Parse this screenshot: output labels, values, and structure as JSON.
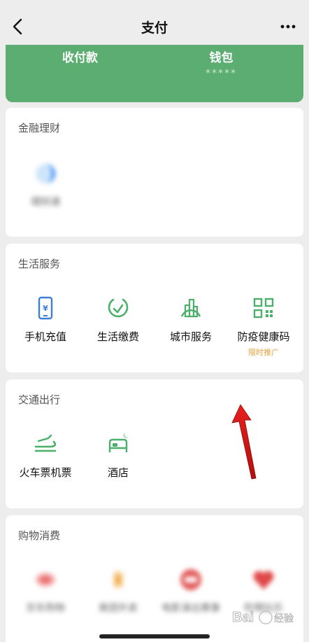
{
  "nav": {
    "title": "支付",
    "back_icon": "chevron-left-icon",
    "more_icon": "more-dots-icon"
  },
  "wallet": {
    "receive_label": "收付款",
    "wallet_label": "钱包",
    "wallet_balance": "*****",
    "color": "#5cad72"
  },
  "finance": {
    "title": "金融理财",
    "items": [
      {
        "label": "理财通",
        "icon": "licaitong-icon"
      }
    ]
  },
  "life": {
    "title": "生活服务",
    "items": [
      {
        "label": "手机充值",
        "icon": "phone-recharge-icon"
      },
      {
        "label": "生活缴费",
        "icon": "utility-payment-icon"
      },
      {
        "label": "城市服务",
        "icon": "city-service-icon"
      },
      {
        "label": "防疫健康码",
        "icon": "health-code-icon",
        "tag": "限时推广"
      }
    ]
  },
  "transport": {
    "title": "交通出行",
    "items": [
      {
        "label": "火车票机票",
        "icon": "train-ticket-icon"
      },
      {
        "label": "酒店",
        "icon": "hotel-icon"
      }
    ]
  },
  "shopping": {
    "title": "购物消费",
    "items": [
      {
        "label": "京东购物",
        "icon": "jd-icon"
      },
      {
        "label": "美团外卖",
        "icon": "meituan-icon"
      },
      {
        "label": "电影演出赛事",
        "icon": "movie-icon"
      },
      {
        "label": "吃喝玩乐",
        "icon": "heart-icon"
      }
    ]
  },
  "watermark": {
    "text": "Bai 经验"
  },
  "colors": {
    "accent_green": "#5cad72",
    "icon_blue": "#3f7fdc",
    "icon_green": "#4caf6a",
    "tag_orange": "#e6a23c"
  }
}
